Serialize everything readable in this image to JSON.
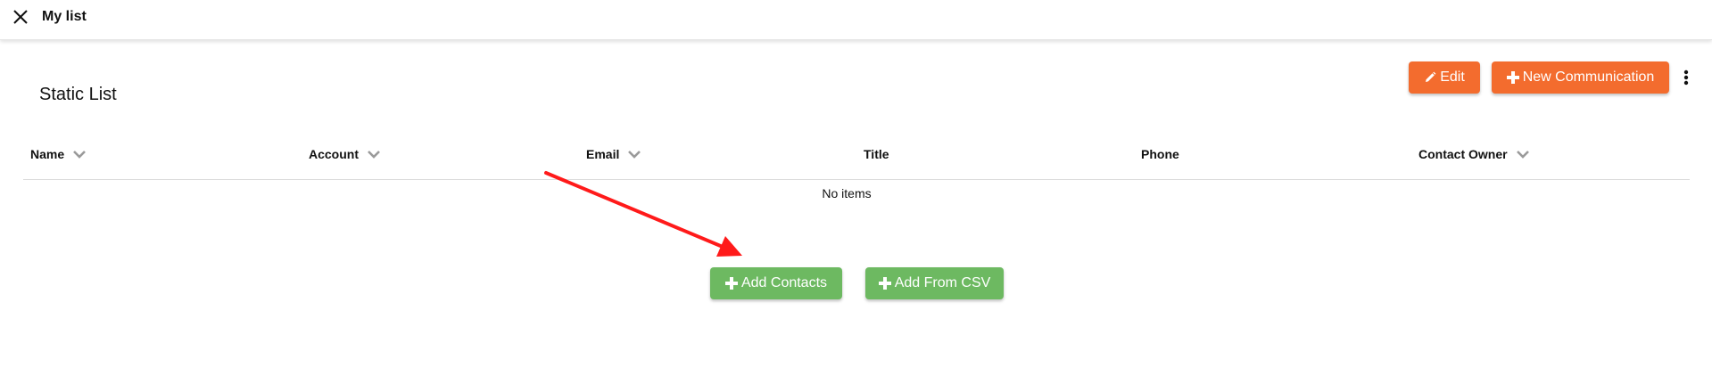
{
  "header": {
    "title": "My list",
    "close_icon": "close-icon"
  },
  "page": {
    "list_type_title": "Static List"
  },
  "actions": {
    "edit_label": "Edit",
    "new_communication_label": "New Communication",
    "more_icon": "more-vertical-icon"
  },
  "table": {
    "columns": [
      {
        "label": "Name",
        "sortable": true
      },
      {
        "label": "Account",
        "sortable": true
      },
      {
        "label": "Email",
        "sortable": true
      },
      {
        "label": "Title",
        "sortable": false
      },
      {
        "label": "Phone",
        "sortable": false
      },
      {
        "label": "Contact Owner",
        "sortable": true
      }
    ],
    "empty_message": "No items"
  },
  "empty_actions": {
    "add_contacts_label": "Add Contacts",
    "add_from_csv_label": "Add From CSV"
  },
  "colors": {
    "orange": "#f36c2e",
    "green": "#6db961",
    "annotation_arrow": "#ff0000"
  }
}
